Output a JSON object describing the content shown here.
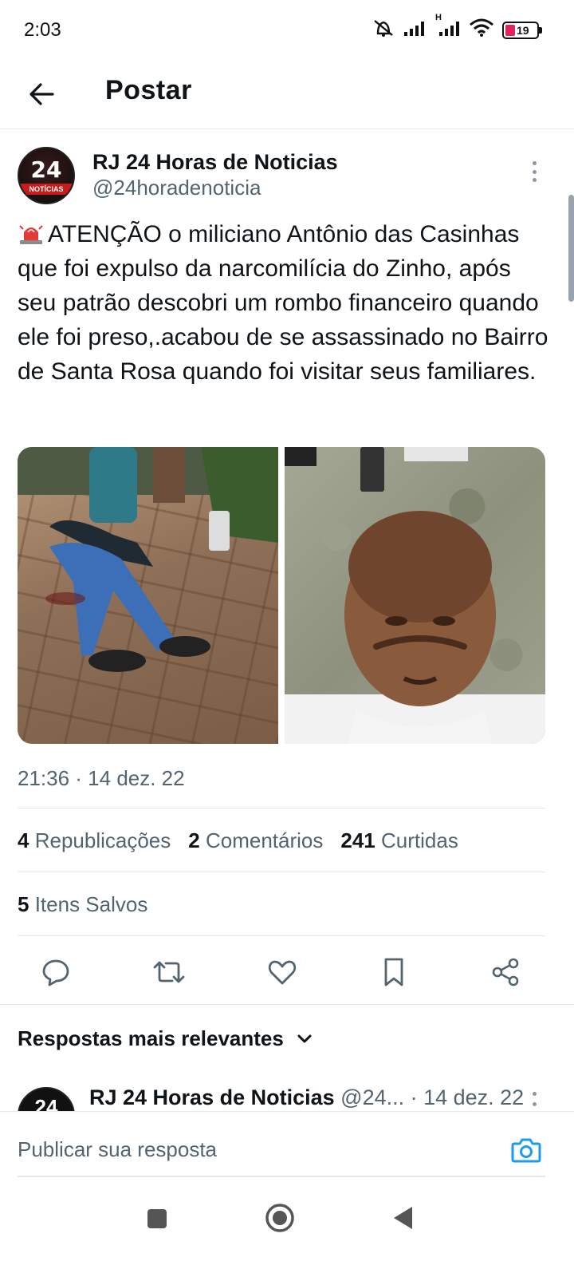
{
  "status_bar": {
    "time": "2:03",
    "battery": "19",
    "network_label": "H"
  },
  "header": {
    "title": "Postar"
  },
  "post": {
    "author_name": "RJ 24 Horas de Noticias",
    "author_handle": "@24horadenoticia",
    "avatar_text_top": "24",
    "avatar_text_bar": "NOTÍCIAS",
    "text": "ATENÇÃO o miliciano Antônio das Casinhas que foi expulso da narcomilícia do Zinho, após seu patrão descobri um rombo financeiro quando ele foi preso,.acabou de se assassinado no Bairro de Santa Rosa quando foi visitar seus familiares.",
    "text_prefix_emoji": "rotating-light",
    "timestamp": "21:36 · 14 dez. 22",
    "stats": {
      "reposts_count": "4",
      "reposts_label": "Republicações",
      "comments_count": "2",
      "comments_label": "Comentários",
      "likes_count": "241",
      "likes_label": "Curtidas",
      "saved_count": "5",
      "saved_label": "Itens Salvos"
    }
  },
  "replies": {
    "sort_label": "Respostas mais relevantes",
    "first_reply": {
      "name": "RJ 24 Horas de Noticias",
      "meta": "@24... · 14 dez. 22"
    }
  },
  "composer": {
    "placeholder": "Publicar sua resposta"
  },
  "colors": {
    "accent": "#1d9bf0",
    "text_primary": "#0f1419",
    "text_secondary": "#536471",
    "divider": "#e6e9ec"
  }
}
